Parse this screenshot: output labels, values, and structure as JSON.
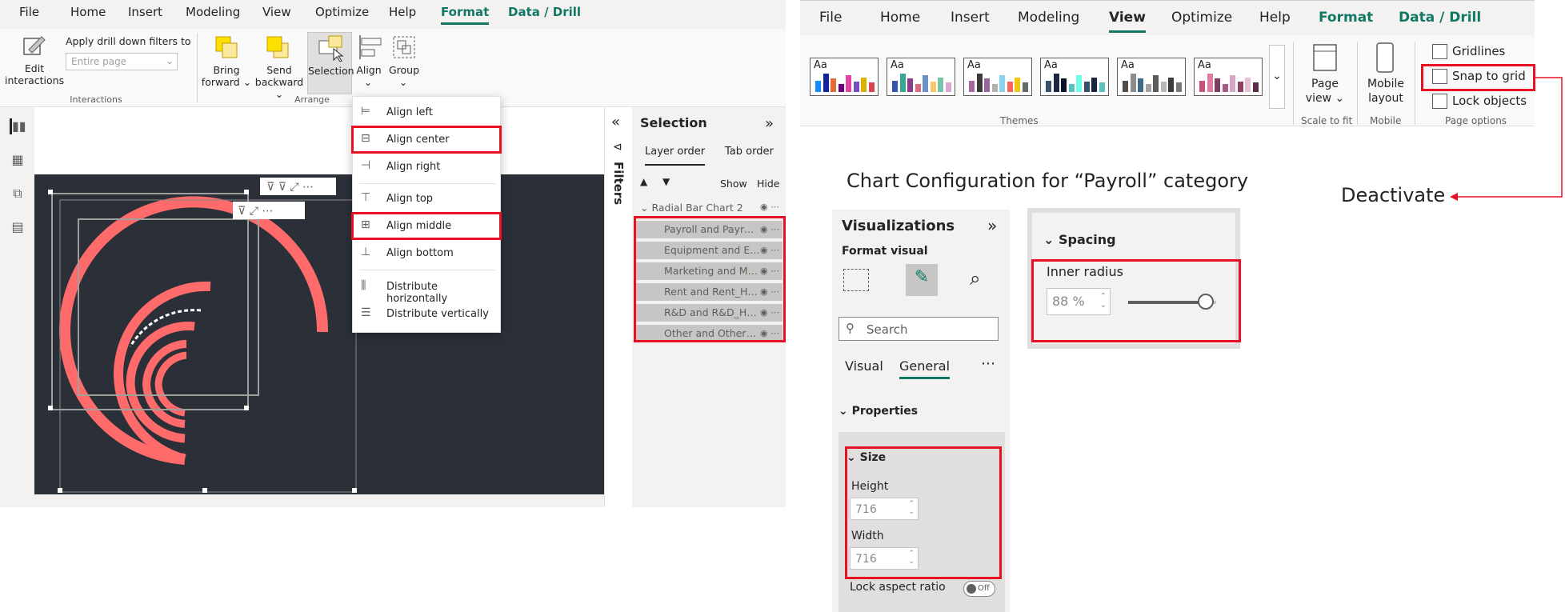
{
  "left": {
    "menu": [
      "File",
      "Home",
      "Insert",
      "Modeling",
      "View",
      "Optimize",
      "Help",
      "Format",
      "Data / Drill"
    ],
    "ribbon": {
      "edit_interactions": "Edit interactions",
      "apply_drill": "Apply drill down filters to",
      "entire_page": "Entire page",
      "interactions_group": "Interactions",
      "bring_forward": "Bring forward",
      "send_backward": "Send backward",
      "selection": "Selection",
      "align": "Align",
      "group": "Group",
      "arrange_group": "Arrange"
    },
    "align_menu": [
      "Align left",
      "Align center",
      "Align right",
      "Align top",
      "Align middle",
      "Align bottom",
      "Distribute horizontally",
      "Distribute vertically"
    ],
    "filters_label": "Filters",
    "selection_pane": {
      "title": "Selection",
      "tabs": [
        "Layer order",
        "Tab order"
      ],
      "show": "Show",
      "hide": "Hide",
      "group": "Radial Bar Chart 2",
      "items": [
        "Payroll and Payroll...",
        "Equipment and Eq...",
        "Marketing and Ma...",
        "Rent and Rent_Hel...",
        "R&D and R&D_Hel...",
        "Other and Other_..."
      ]
    }
  },
  "right": {
    "menu": [
      "File",
      "Home",
      "Insert",
      "Modeling",
      "View",
      "Optimize",
      "Help",
      "Format",
      "Data / Drill"
    ],
    "themes_label": "Themes",
    "page_view": "Page view",
    "scale_to_fit": "Scale to fit",
    "mobile_layout": "Mobile layout",
    "mobile": "Mobile",
    "gridlines": "Gridlines",
    "snap_to_grid": "Snap to grid",
    "lock_objects": "Lock objects",
    "page_options": "Page options",
    "heading": "Chart Configuration for “Payroll” category",
    "deactivate": "Deactivate",
    "viz": {
      "title": "Visualizations",
      "format_visual": "Format visual",
      "search": "Search",
      "tab_visual": "Visual",
      "tab_general": "General",
      "properties": "Properties",
      "size": "Size",
      "height_label": "Height",
      "height_value": "716",
      "width_label": "Width",
      "width_value": "716",
      "lock_aspect": "Lock aspect ratio",
      "toggle_off": "Off"
    },
    "spacing": {
      "title": "Spacing",
      "inner_radius": "Inner radius",
      "value": "88 %",
      "slider_fraction": 0.88
    },
    "accent_color": "#e81123",
    "brand_green": "#117865"
  }
}
